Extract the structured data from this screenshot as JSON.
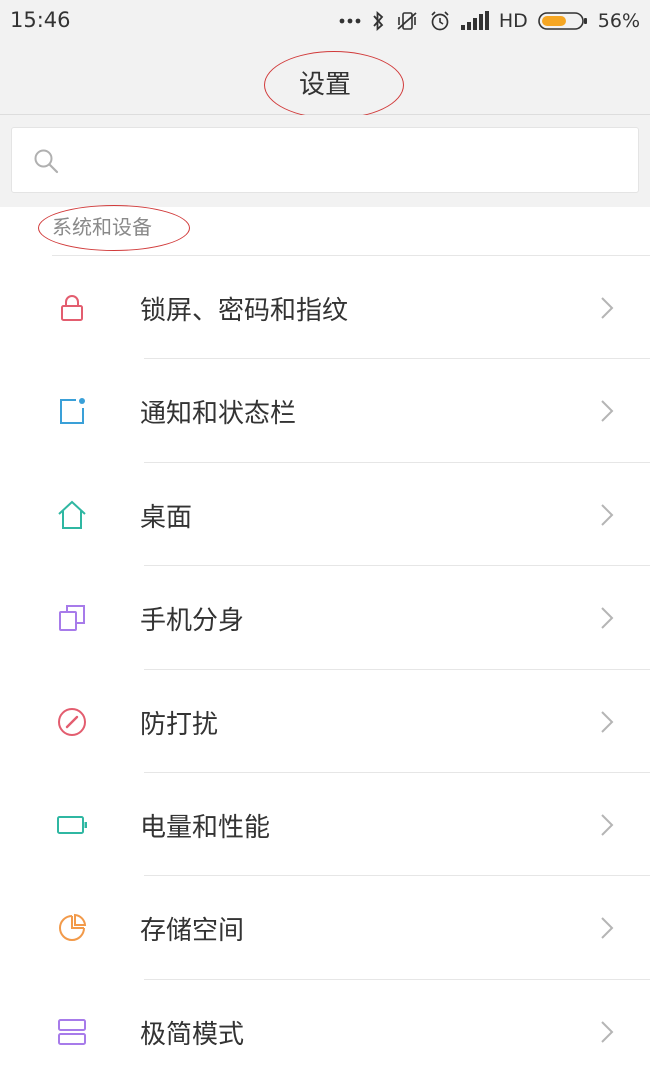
{
  "status_bar": {
    "time": "15:46",
    "signal_label": "HD",
    "battery_percent": "56%"
  },
  "header": {
    "title": "设置"
  },
  "search": {
    "placeholder": "",
    "value": ""
  },
  "section": {
    "title": "系统和设备"
  },
  "items": [
    {
      "label": "锁屏、密码和指纹",
      "icon": "lock-icon",
      "color": "#e35d6f"
    },
    {
      "label": "通知和状态栏",
      "icon": "notification-icon",
      "color": "#3aa0d8"
    },
    {
      "label": "桌面",
      "icon": "home-icon",
      "color": "#2fb7a2"
    },
    {
      "label": "手机分身",
      "icon": "dual-app-icon",
      "color": "#a77bea"
    },
    {
      "label": "防打扰",
      "icon": "do-not-disturb-icon",
      "color": "#e35d6f"
    },
    {
      "label": "电量和性能",
      "icon": "battery-icon",
      "color": "#2fb7a2"
    },
    {
      "label": "存储空间",
      "icon": "storage-pie-icon",
      "color": "#f29a4a"
    },
    {
      "label": "极简模式",
      "icon": "simple-mode-icon",
      "color": "#a77bea"
    }
  ]
}
